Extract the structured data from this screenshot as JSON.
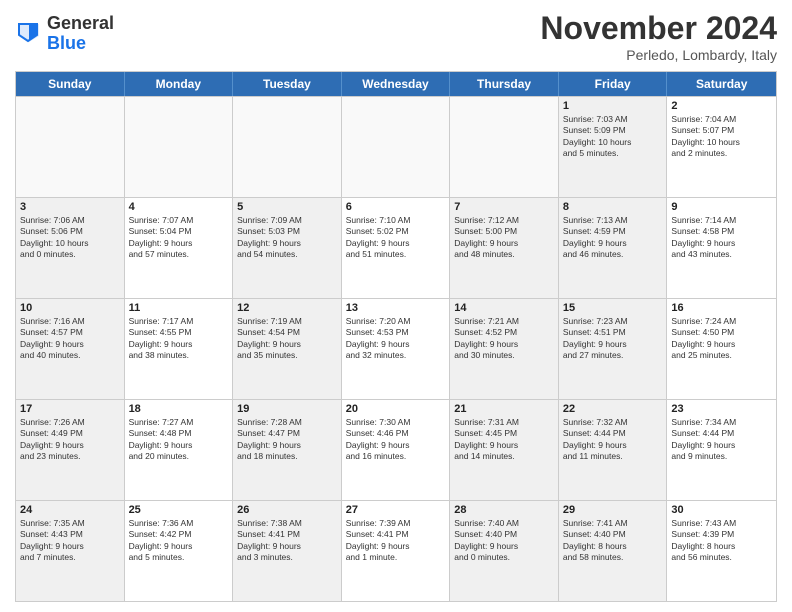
{
  "header": {
    "logo_general": "General",
    "logo_blue": "Blue",
    "month_year": "November 2024",
    "location": "Perledo, Lombardy, Italy"
  },
  "weekdays": [
    "Sunday",
    "Monday",
    "Tuesday",
    "Wednesday",
    "Thursday",
    "Friday",
    "Saturday"
  ],
  "rows": [
    [
      {
        "day": "",
        "info": "",
        "empty": true
      },
      {
        "day": "",
        "info": "",
        "empty": true
      },
      {
        "day": "",
        "info": "",
        "empty": true
      },
      {
        "day": "",
        "info": "",
        "empty": true
      },
      {
        "day": "",
        "info": "",
        "empty": true
      },
      {
        "day": "1",
        "info": "Sunrise: 7:03 AM\nSunset: 5:09 PM\nDaylight: 10 hours\nand 5 minutes.",
        "shaded": true
      },
      {
        "day": "2",
        "info": "Sunrise: 7:04 AM\nSunset: 5:07 PM\nDaylight: 10 hours\nand 2 minutes."
      }
    ],
    [
      {
        "day": "3",
        "info": "Sunrise: 7:06 AM\nSunset: 5:06 PM\nDaylight: 10 hours\nand 0 minutes.",
        "shaded": true
      },
      {
        "day": "4",
        "info": "Sunrise: 7:07 AM\nSunset: 5:04 PM\nDaylight: 9 hours\nand 57 minutes."
      },
      {
        "day": "5",
        "info": "Sunrise: 7:09 AM\nSunset: 5:03 PM\nDaylight: 9 hours\nand 54 minutes.",
        "shaded": true
      },
      {
        "day": "6",
        "info": "Sunrise: 7:10 AM\nSunset: 5:02 PM\nDaylight: 9 hours\nand 51 minutes."
      },
      {
        "day": "7",
        "info": "Sunrise: 7:12 AM\nSunset: 5:00 PM\nDaylight: 9 hours\nand 48 minutes.",
        "shaded": true
      },
      {
        "day": "8",
        "info": "Sunrise: 7:13 AM\nSunset: 4:59 PM\nDaylight: 9 hours\nand 46 minutes.",
        "shaded": true
      },
      {
        "day": "9",
        "info": "Sunrise: 7:14 AM\nSunset: 4:58 PM\nDaylight: 9 hours\nand 43 minutes."
      }
    ],
    [
      {
        "day": "10",
        "info": "Sunrise: 7:16 AM\nSunset: 4:57 PM\nDaylight: 9 hours\nand 40 minutes.",
        "shaded": true
      },
      {
        "day": "11",
        "info": "Sunrise: 7:17 AM\nSunset: 4:55 PM\nDaylight: 9 hours\nand 38 minutes."
      },
      {
        "day": "12",
        "info": "Sunrise: 7:19 AM\nSunset: 4:54 PM\nDaylight: 9 hours\nand 35 minutes.",
        "shaded": true
      },
      {
        "day": "13",
        "info": "Sunrise: 7:20 AM\nSunset: 4:53 PM\nDaylight: 9 hours\nand 32 minutes."
      },
      {
        "day": "14",
        "info": "Sunrise: 7:21 AM\nSunset: 4:52 PM\nDaylight: 9 hours\nand 30 minutes.",
        "shaded": true
      },
      {
        "day": "15",
        "info": "Sunrise: 7:23 AM\nSunset: 4:51 PM\nDaylight: 9 hours\nand 27 minutes.",
        "shaded": true
      },
      {
        "day": "16",
        "info": "Sunrise: 7:24 AM\nSunset: 4:50 PM\nDaylight: 9 hours\nand 25 minutes."
      }
    ],
    [
      {
        "day": "17",
        "info": "Sunrise: 7:26 AM\nSunset: 4:49 PM\nDaylight: 9 hours\nand 23 minutes.",
        "shaded": true
      },
      {
        "day": "18",
        "info": "Sunrise: 7:27 AM\nSunset: 4:48 PM\nDaylight: 9 hours\nand 20 minutes."
      },
      {
        "day": "19",
        "info": "Sunrise: 7:28 AM\nSunset: 4:47 PM\nDaylight: 9 hours\nand 18 minutes.",
        "shaded": true
      },
      {
        "day": "20",
        "info": "Sunrise: 7:30 AM\nSunset: 4:46 PM\nDaylight: 9 hours\nand 16 minutes."
      },
      {
        "day": "21",
        "info": "Sunrise: 7:31 AM\nSunset: 4:45 PM\nDaylight: 9 hours\nand 14 minutes.",
        "shaded": true
      },
      {
        "day": "22",
        "info": "Sunrise: 7:32 AM\nSunset: 4:44 PM\nDaylight: 9 hours\nand 11 minutes.",
        "shaded": true
      },
      {
        "day": "23",
        "info": "Sunrise: 7:34 AM\nSunset: 4:44 PM\nDaylight: 9 hours\nand 9 minutes."
      }
    ],
    [
      {
        "day": "24",
        "info": "Sunrise: 7:35 AM\nSunset: 4:43 PM\nDaylight: 9 hours\nand 7 minutes.",
        "shaded": true
      },
      {
        "day": "25",
        "info": "Sunrise: 7:36 AM\nSunset: 4:42 PM\nDaylight: 9 hours\nand 5 minutes."
      },
      {
        "day": "26",
        "info": "Sunrise: 7:38 AM\nSunset: 4:41 PM\nDaylight: 9 hours\nand 3 minutes.",
        "shaded": true
      },
      {
        "day": "27",
        "info": "Sunrise: 7:39 AM\nSunset: 4:41 PM\nDaylight: 9 hours\nand 1 minute."
      },
      {
        "day": "28",
        "info": "Sunrise: 7:40 AM\nSunset: 4:40 PM\nDaylight: 9 hours\nand 0 minutes.",
        "shaded": true
      },
      {
        "day": "29",
        "info": "Sunrise: 7:41 AM\nSunset: 4:40 PM\nDaylight: 8 hours\nand 58 minutes.",
        "shaded": true
      },
      {
        "day": "30",
        "info": "Sunrise: 7:43 AM\nSunset: 4:39 PM\nDaylight: 8 hours\nand 56 minutes."
      }
    ]
  ]
}
